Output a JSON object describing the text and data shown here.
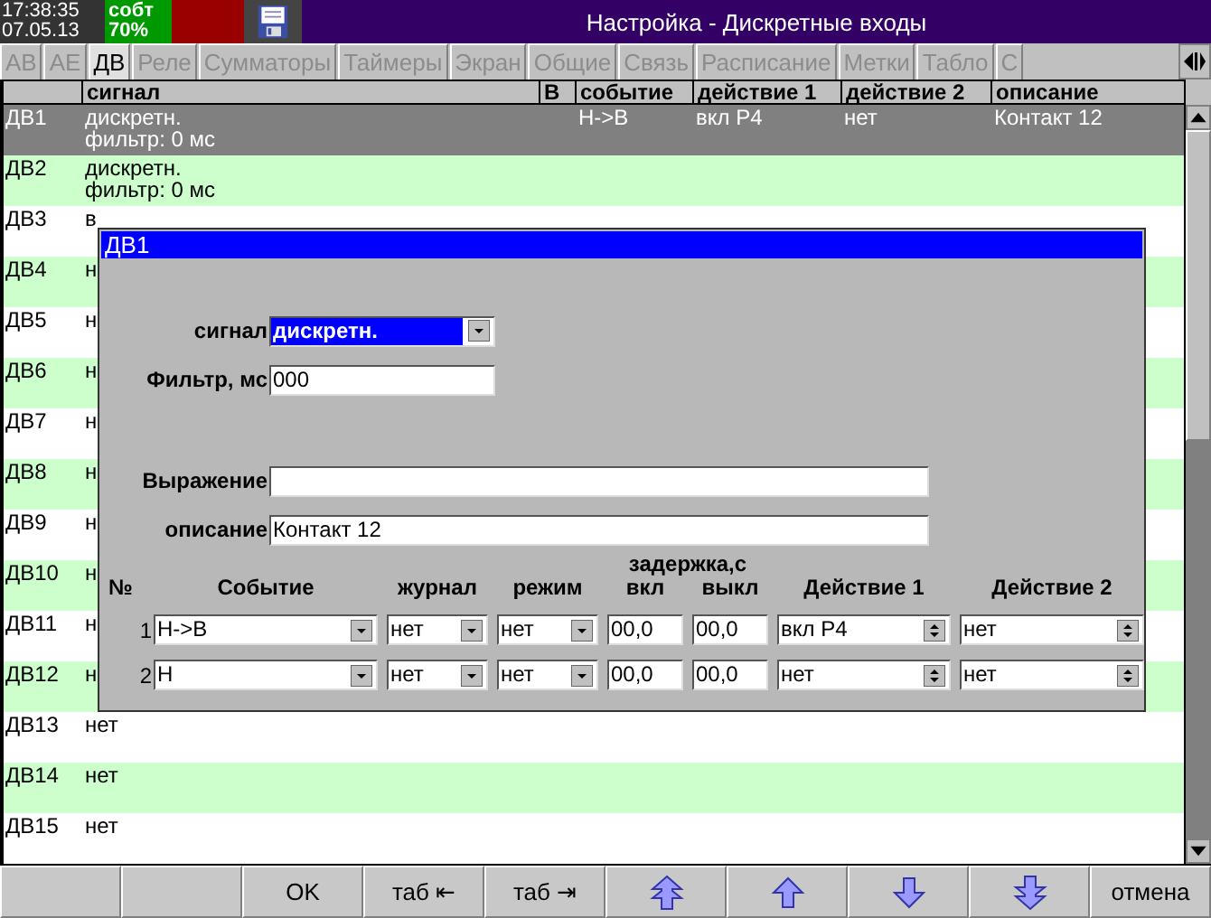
{
  "status": {
    "time": "17:38:35",
    "date": "07.05.13",
    "mode": "собт",
    "percent": "70%"
  },
  "window": {
    "title": "Настройка - Дискретные входы"
  },
  "tabs": [
    {
      "label": "АВ",
      "selected": false
    },
    {
      "label": "АЕ",
      "selected": false
    },
    {
      "label": "ДВ",
      "selected": true
    },
    {
      "label": "Реле",
      "selected": false
    },
    {
      "label": "Сумматоры",
      "selected": false
    },
    {
      "label": "Таймеры",
      "selected": false
    },
    {
      "label": "Экран",
      "selected": false
    },
    {
      "label": "Общие",
      "selected": false
    },
    {
      "label": "Связь",
      "selected": false
    },
    {
      "label": "Расписание",
      "selected": false
    },
    {
      "label": "Метки",
      "selected": false
    },
    {
      "label": "Табло",
      "selected": false
    },
    {
      "label": "С",
      "selected": false
    }
  ],
  "table": {
    "columns": [
      "сигнал",
      "В",
      "событие",
      "действие 1",
      "действие 2",
      "описание"
    ],
    "rows": [
      {
        "label": "ДВ1",
        "signal": [
          "дискретн.",
          "фильтр: 0 мс"
        ],
        "event": "Н->В",
        "action1": "вкл Р4",
        "action2": "нет",
        "description": "Контакт 12",
        "selected": true
      },
      {
        "label": "ДВ2",
        "signal": [
          "дискретн.",
          "фильтр: 0 мс"
        ],
        "selected": false
      },
      {
        "label": "ДВ3",
        "signal": [
          "в"
        ],
        "selected": false
      },
      {
        "label": "ДВ4",
        "signal": [
          "н"
        ],
        "selected": false
      },
      {
        "label": "ДВ5",
        "signal": [
          "н"
        ],
        "selected": false
      },
      {
        "label": "ДВ6",
        "signal": [
          "н"
        ],
        "selected": false
      },
      {
        "label": "ДВ7",
        "signal": [
          "н"
        ],
        "selected": false
      },
      {
        "label": "ДВ8",
        "signal": [
          "н"
        ],
        "selected": false
      },
      {
        "label": "ДВ9",
        "signal": [
          "н"
        ],
        "selected": false
      },
      {
        "label": "ДВ10",
        "signal": [
          "н"
        ],
        "selected": false
      },
      {
        "label": "ДВ11",
        "signal": [
          "н"
        ],
        "selected": false
      },
      {
        "label": "ДВ12",
        "signal": [
          "н"
        ],
        "selected": false
      },
      {
        "label": "ДВ13",
        "signal": [
          "нет"
        ],
        "selected": false
      },
      {
        "label": "ДВ14",
        "signal": [
          "нет"
        ],
        "selected": false
      },
      {
        "label": "ДВ15",
        "signal": [
          "нет"
        ],
        "selected": false
      }
    ]
  },
  "dialog": {
    "title": "ДВ1",
    "signal": {
      "label": "сигнал",
      "value": "дискретн."
    },
    "filter": {
      "label": "Фильтр, мс",
      "value": "000"
    },
    "expression": {
      "label": "Выражение"
    },
    "description": {
      "label": "описание",
      "value": "Контакт 12"
    },
    "delay_header": "задержка,с",
    "headers": [
      "№",
      "Событие",
      "журнал",
      "режим",
      "вкл",
      "выкл",
      "Действие 1",
      "Действие 2"
    ],
    "rows": [
      {
        "num": "1",
        "event": "Н->В",
        "journal": "нет",
        "mode": "нет",
        "on": "00,0",
        "off": "00,0",
        "action1": "вкл Р4",
        "action2": "нет"
      },
      {
        "num": "2",
        "event": "Н",
        "journal": "нет",
        "mode": "нет",
        "on": "00,0",
        "off": "00,0",
        "action1": "нет",
        "action2": "нет"
      }
    ]
  },
  "buttons": [
    {
      "kind": "blank"
    },
    {
      "kind": "blank"
    },
    {
      "kind": "text",
      "label": "OK"
    },
    {
      "kind": "text",
      "label": "таб ⇤"
    },
    {
      "kind": "text",
      "label": "таб ⇥"
    },
    {
      "kind": "up2"
    },
    {
      "kind": "up"
    },
    {
      "kind": "down"
    },
    {
      "kind": "down2"
    },
    {
      "kind": "text",
      "label": "отмена"
    }
  ]
}
